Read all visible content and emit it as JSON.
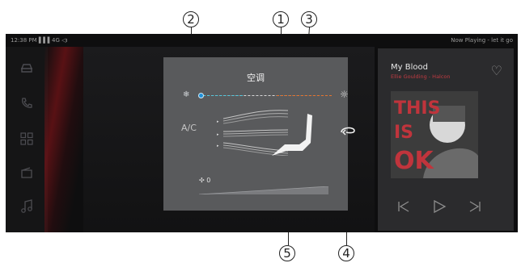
{
  "callouts": [
    "1",
    "2",
    "3",
    "4",
    "5"
  ],
  "status_bar": {
    "time": "12:38 PM",
    "network": "4G",
    "now_playing": "Now Playing - let it go"
  },
  "sidebar": [
    "car-icon",
    "phone-icon",
    "apps-grid-icon",
    "folder-icon",
    "music-note-icon"
  ],
  "ac": {
    "title": "空调",
    "ac_label": "A/C",
    "fan_speed": "0",
    "temperature_level": 0.0,
    "colors": {
      "cold": "#4fc7de",
      "neutral": "#d7d7d7",
      "warm": "#e5742f",
      "knob": "#1f8fd8",
      "panel": "#595a5c"
    }
  },
  "music": {
    "title": "My Blood",
    "artist": "Ellie Goulding - Halcon",
    "album_art_text": "THIS IS OK",
    "accent": "#c23b42"
  }
}
